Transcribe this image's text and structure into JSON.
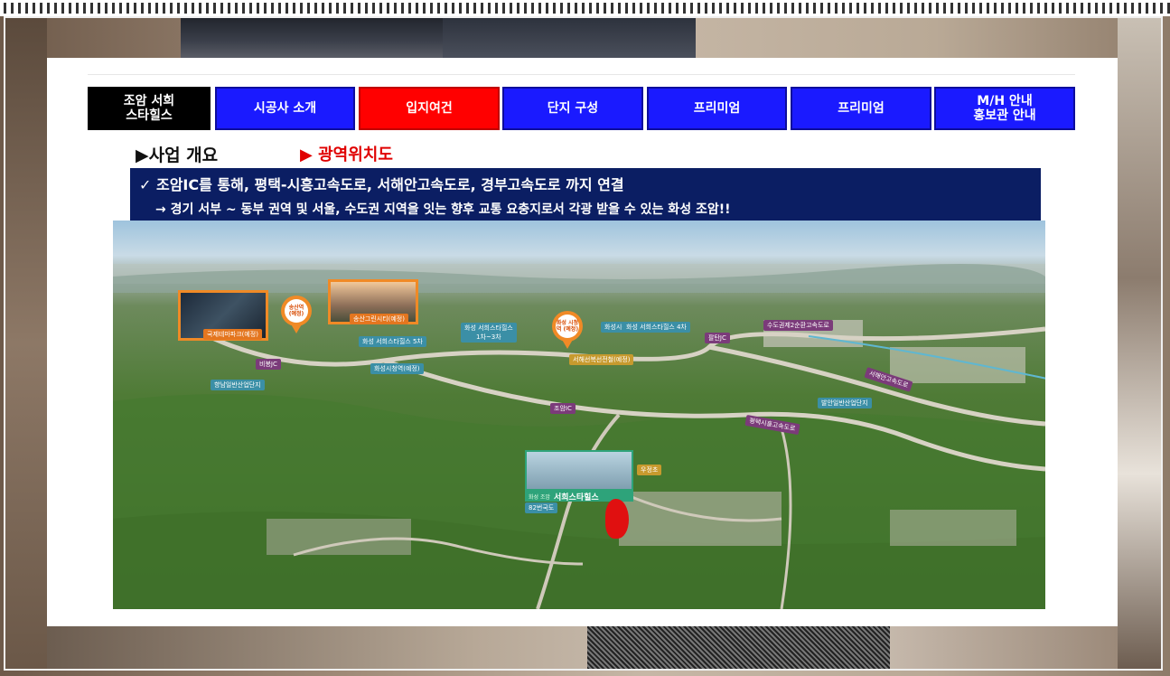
{
  "tabs": [
    {
      "label": "조암 서희\n스타힐스",
      "style": "black"
    },
    {
      "label": "시공사 소개",
      "style": "blue"
    },
    {
      "label": "입지여건",
      "style": "red"
    },
    {
      "label": "단지 구성",
      "style": "blue"
    },
    {
      "label": "프리미엄",
      "style": "blue"
    },
    {
      "label": "프리미엄",
      "style": "blue"
    },
    {
      "label": "M/H 안내\n홍보관 안내",
      "style": "blue"
    }
  ],
  "section": {
    "heading": "▶사업 개요",
    "sub_heading": "▶ 광역위치도"
  },
  "banner": {
    "line1": "✓ 조암IC를 통해, 평택-시흥고속도로, 서해안고속도로, 경부고속도로 까지 연결",
    "line2": "→ 경기 서부 ~ 동부 권역 및 서울, 수도권 지역을 잇는 향후 교통 요충지로서 각광 받을 수 있는 화성 조암!!"
  },
  "map": {
    "pins": {
      "songsan": "송산역\n(예정)",
      "hwaseong": "화성\n시청역\n(예정)"
    },
    "photo_captions": {
      "theme_park": "국제테마파크(예정)",
      "greencity": "송산그린시티(예정)"
    },
    "labels": {
      "starhills_5": "화성 서희스타힐스 5차",
      "starhills_1_3": "화성 서희스타힐스\n1차~3차",
      "starhills_1": "화성시청",
      "starhills_4": "화성 서희스타힐스 4차",
      "suwon_ring": "수도권제2순환고속도로",
      "palgok_ic": "팔탄JC",
      "ido_jc": "비봉JC",
      "hwaseong_station": "화성시청역(예정)",
      "industrial": "향남일반산업단지",
      "industrial2": "발안일반산업단지",
      "expressway": "서해안고속도로",
      "joam_ic": "조암IC",
      "pyeongtaek": "평택시흥고속도로",
      "route82": "82번국도",
      "starhills_joam": "서희스타힐스",
      "joam_small": "화성 조암",
      "school": "우정초",
      "west_line": "서해선복선전철(예정)"
    }
  }
}
